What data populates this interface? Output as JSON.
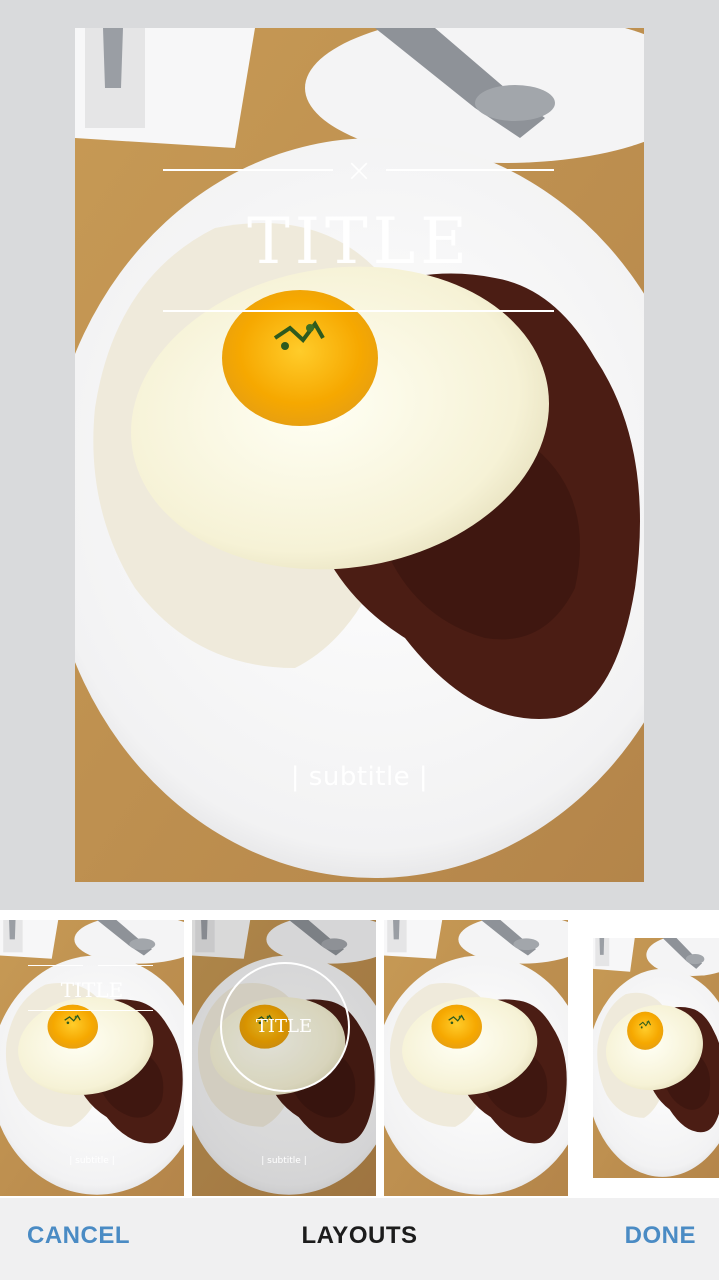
{
  "preview": {
    "close_glyph": "×",
    "title": "TITLE",
    "subtitle": "| subtitle |"
  },
  "layouts": [
    {
      "name": "classic-title",
      "title": "TITLE",
      "subtitle": "| subtitle |",
      "selected": true
    },
    {
      "name": "circle-title",
      "title": "TITLE",
      "subtitle": "| subtitle |",
      "selected": false
    },
    {
      "name": "plain",
      "selected": false
    },
    {
      "name": "framed",
      "selected": false
    }
  ],
  "bottom_bar": {
    "cancel_label": "CANCEL",
    "title": "LAYOUTS",
    "done_label": "DONE"
  },
  "colors": {
    "accent": "#4a90c9",
    "background": "#d9dadc",
    "bar": "#f0f0f1"
  }
}
